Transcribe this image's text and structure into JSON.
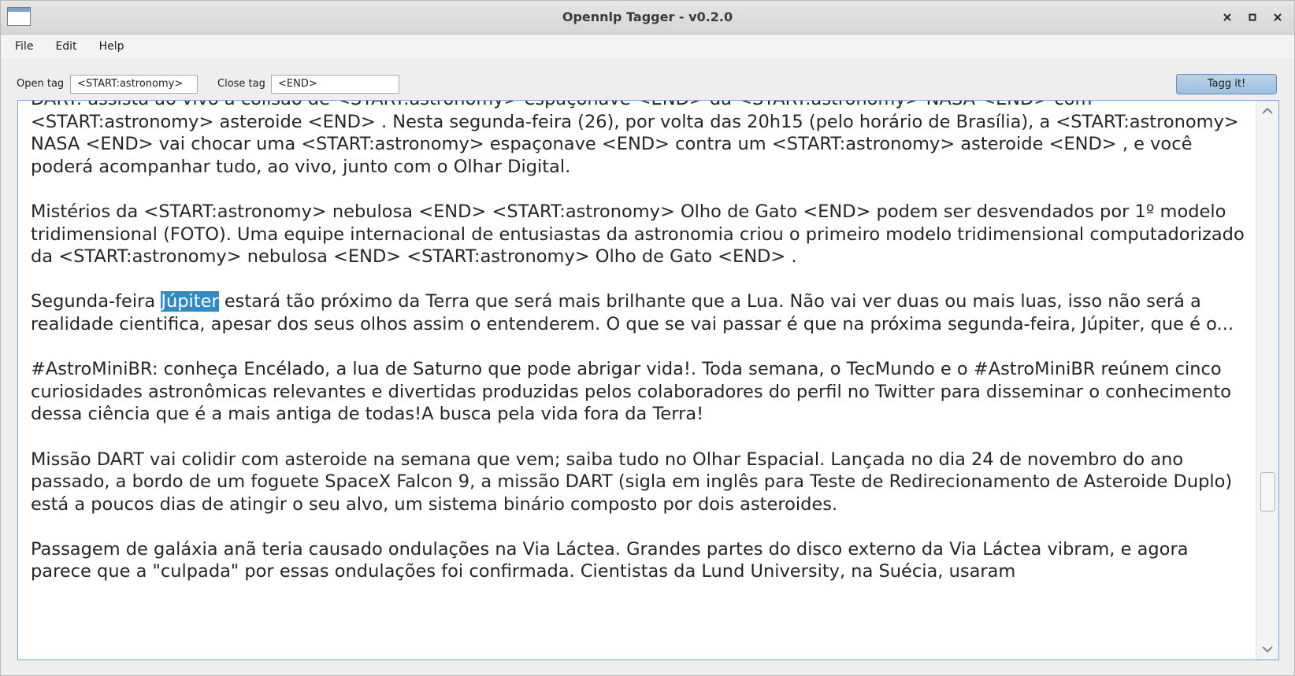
{
  "window": {
    "title": "Opennlp Tagger - v0.2.0",
    "controls": {
      "minimize": "×",
      "maximize": "▫",
      "close": "×"
    }
  },
  "menu": [
    "File",
    "Edit",
    "Help"
  ],
  "toolbar": {
    "open_tag_label": "Open tag",
    "open_tag_value": "<START:astronomy>",
    "close_tag_label": "Close tag",
    "close_tag_value": "<END>",
    "tag_button": "Tagg it!"
  },
  "editor": {
    "selected_word": "Júpiter",
    "paragraphs": [
      "DART: assista ao vivo à colisão de <START:astronomy> espaçonave <END> da <START:astronomy> NASA <END> com <START:astronomy> asteroide <END> . Nesta segunda-feira (26), por volta das 20h15 (pelo horário de Brasília), a <START:astronomy> NASA <END> vai chocar uma <START:astronomy> espaçonave <END> contra um <START:astronomy> asteroide <END> , e você poderá acompanhar tudo, ao vivo, junto com o Olhar Digital.",
      "",
      "Mistérios da <START:astronomy> nebulosa <END> <START:astronomy> Olho de Gato <END> podem ser desvendados por 1º modelo tridimensional (FOTO). Uma equipe internacional de entusiastas da astronomia criou o primeiro modelo tridimensional computadorizado da <START:astronomy> nebulosa <END> <START:astronomy> Olho de Gato <END> .",
      "",
      "Segunda-feira Júpiter estará tão próximo da Terra que será mais brilhante que a Lua. Não vai ver duas ou mais luas, isso não será a realidade cientifica, apesar dos seus olhos assim o entenderem. O que se vai passar é que na próxima segunda-feira, Júpiter, que é o...",
      "",
      "#AstroMiniBR: conheça Encélado, a lua de Saturno que pode abrigar vida!. Toda semana, o TecMundo e o #AstroMiniBR reúnem cinco curiosidades astronômicas relevantes e divertidas produzidas pelos colaboradores do perfil no Twitter para disseminar o conhecimento dessa ciência que é a mais antiga de todas!A busca pela vida fora da Terra!",
      "",
      "Missão DART vai colidir com asteroide na semana que vem; saiba tudo no Olhar Espacial. Lançada no dia 24 de novembro do ano passado, a bordo de um foguete SpaceX Falcon 9, a missão DART (sigla em inglês para Teste de Redirecionamento de Asteroide Duplo) está a poucos dias de atingir o seu alvo, um sistema binário composto por dois asteroides.",
      "",
      "Passagem de galáxia anã teria causado ondulações na Via Láctea. Grandes partes do disco externo da Via Láctea vibram, e agora parece que a \"culpada\" por essas ondulações foi confirmada. Cientistas da Lund University, na Suécia, usaram"
    ]
  },
  "scrollbar": {
    "up": "︿",
    "down": "﹀"
  }
}
